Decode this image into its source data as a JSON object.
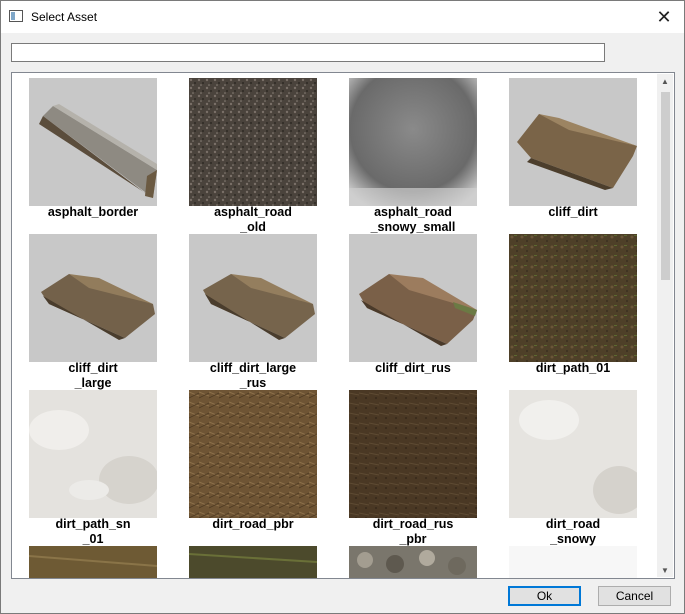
{
  "window": {
    "title": "Select Asset",
    "close_glyph": "✕"
  },
  "search": {
    "value": "",
    "placeholder": ""
  },
  "assets": [
    {
      "label": "asphalt_border",
      "icon": "asphalt-border-thumbnail"
    },
    {
      "label": "asphalt_road\n_old",
      "icon": "asphalt-road-old-thumbnail"
    },
    {
      "label": "asphalt_road\n_snowy_small",
      "icon": "asphalt-road-snowy-small-thumbnail"
    },
    {
      "label": "cliff_dirt",
      "icon": "cliff-dirt-thumbnail"
    },
    {
      "label": "cliff_dirt\n_large",
      "icon": "cliff-dirt-large-thumbnail"
    },
    {
      "label": "cliff_dirt_large\n_rus",
      "icon": "cliff-dirt-large-rus-thumbnail"
    },
    {
      "label": "cliff_dirt_rus",
      "icon": "cliff-dirt-rus-thumbnail"
    },
    {
      "label": "dirt_path_01",
      "icon": "dirt-path-01-thumbnail"
    },
    {
      "label": "dirt_path_sn\n_01",
      "icon": "dirt-path-sn-01-thumbnail"
    },
    {
      "label": "dirt_road_pbr",
      "icon": "dirt-road-pbr-thumbnail"
    },
    {
      "label": "dirt_road_rus\n_pbr",
      "icon": "dirt-road-rus-pbr-thumbnail"
    },
    {
      "label": "dirt_road\n_snowy",
      "icon": "dirt-road-snowy-thumbnail"
    }
  ],
  "buttons": {
    "ok": "Ok",
    "cancel": "Cancel"
  }
}
